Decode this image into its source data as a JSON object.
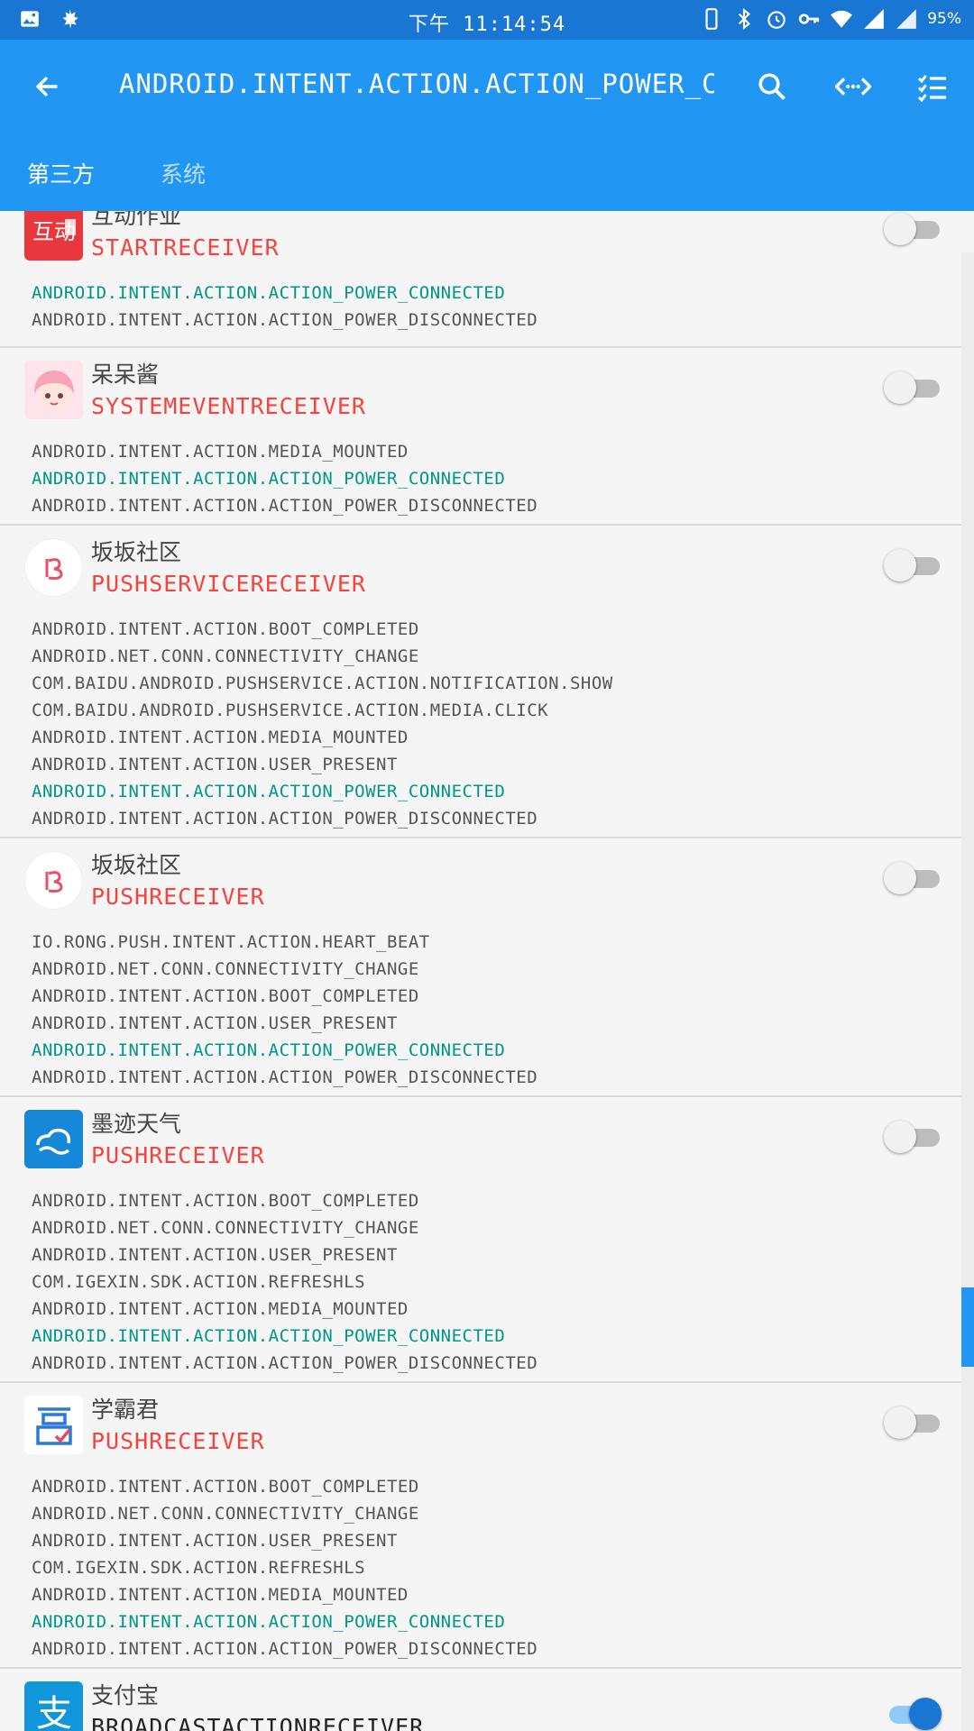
{
  "status_bar": {
    "time": "下午 11:14:54",
    "battery": "95%",
    "icons_left": [
      "image-icon",
      "leaf-icon"
    ],
    "icons_right": [
      "phone-icon",
      "bluetooth-icon",
      "alarm-icon",
      "key-icon",
      "wifi-icon",
      "signal-icon",
      "signal-icon",
      "battery-icon"
    ]
  },
  "toolbar": {
    "title": "ANDROID.INTENT.ACTION.ACTION_POWER_CO...",
    "actions": [
      "search-icon",
      "code-icon",
      "checklist-icon"
    ]
  },
  "tabs": [
    {
      "label": "第三方",
      "active": true
    },
    {
      "label": "系统",
      "active": false
    }
  ],
  "colors": {
    "status_bar": "#1976d2",
    "app_bar": "#2196f3",
    "receiver_disabled": "#f4433a",
    "highlight_action": "#009688"
  },
  "receivers": [
    {
      "app": "互动作业",
      "receiver": "STARTRECEIVER",
      "enabled": false,
      "icon": "hudong-icon",
      "actions": [
        {
          "text": "ANDROID.INTENT.ACTION.ACTION_POWER_CONNECTED",
          "highlight": true
        },
        {
          "text": "ANDROID.INTENT.ACTION.ACTION_POWER_DISCONNECTED",
          "highlight": false
        }
      ]
    },
    {
      "app": "呆呆酱",
      "receiver": "SYSTEMEVENTRECEIVER",
      "enabled": false,
      "icon": "anime-girl-icon",
      "actions": [
        {
          "text": "ANDROID.INTENT.ACTION.MEDIA_MOUNTED",
          "highlight": false
        },
        {
          "text": "ANDROID.INTENT.ACTION.ACTION_POWER_CONNECTED",
          "highlight": true
        },
        {
          "text": "ANDROID.INTENT.ACTION.ACTION_POWER_DISCONNECTED",
          "highlight": false
        }
      ]
    },
    {
      "app": "坂坂社区",
      "receiver": "PUSHSERVICERECEIVER",
      "enabled": false,
      "icon": "banban-icon",
      "actions": [
        {
          "text": "ANDROID.INTENT.ACTION.BOOT_COMPLETED",
          "highlight": false
        },
        {
          "text": "ANDROID.NET.CONN.CONNECTIVITY_CHANGE",
          "highlight": false
        },
        {
          "text": "COM.BAIDU.ANDROID.PUSHSERVICE.ACTION.NOTIFICATION.SHOW",
          "highlight": false
        },
        {
          "text": "COM.BAIDU.ANDROID.PUSHSERVICE.ACTION.MEDIA.CLICK",
          "highlight": false
        },
        {
          "text": "ANDROID.INTENT.ACTION.MEDIA_MOUNTED",
          "highlight": false
        },
        {
          "text": "ANDROID.INTENT.ACTION.USER_PRESENT",
          "highlight": false
        },
        {
          "text": "ANDROID.INTENT.ACTION.ACTION_POWER_CONNECTED",
          "highlight": true
        },
        {
          "text": "ANDROID.INTENT.ACTION.ACTION_POWER_DISCONNECTED",
          "highlight": false
        }
      ]
    },
    {
      "app": "坂坂社区",
      "receiver": "PUSHRECEIVER",
      "enabled": false,
      "icon": "banban-icon",
      "actions": [
        {
          "text": "IO.RONG.PUSH.INTENT.ACTION.HEART_BEAT",
          "highlight": false
        },
        {
          "text": "ANDROID.NET.CONN.CONNECTIVITY_CHANGE",
          "highlight": false
        },
        {
          "text": "ANDROID.INTENT.ACTION.BOOT_COMPLETED",
          "highlight": false
        },
        {
          "text": "ANDROID.INTENT.ACTION.USER_PRESENT",
          "highlight": false
        },
        {
          "text": "ANDROID.INTENT.ACTION.ACTION_POWER_CONNECTED",
          "highlight": true
        },
        {
          "text": "ANDROID.INTENT.ACTION.ACTION_POWER_DISCONNECTED",
          "highlight": false
        }
      ]
    },
    {
      "app": "墨迹天气",
      "receiver": "PUSHRECEIVER",
      "enabled": false,
      "icon": "moji-weather-icon",
      "actions": [
        {
          "text": "ANDROID.INTENT.ACTION.BOOT_COMPLETED",
          "highlight": false
        },
        {
          "text": "ANDROID.NET.CONN.CONNECTIVITY_CHANGE",
          "highlight": false
        },
        {
          "text": "ANDROID.INTENT.ACTION.USER_PRESENT",
          "highlight": false
        },
        {
          "text": "COM.IGEXIN.SDK.ACTION.REFRESHLS",
          "highlight": false
        },
        {
          "text": "ANDROID.INTENT.ACTION.MEDIA_MOUNTED",
          "highlight": false
        },
        {
          "text": "ANDROID.INTENT.ACTION.ACTION_POWER_CONNECTED",
          "highlight": true
        },
        {
          "text": "ANDROID.INTENT.ACTION.ACTION_POWER_DISCONNECTED",
          "highlight": false
        }
      ]
    },
    {
      "app": "学霸君",
      "receiver": "PUSHRECEIVER",
      "enabled": false,
      "icon": "xuebajun-icon",
      "actions": [
        {
          "text": "ANDROID.INTENT.ACTION.BOOT_COMPLETED",
          "highlight": false
        },
        {
          "text": "ANDROID.NET.CONN.CONNECTIVITY_CHANGE",
          "highlight": false
        },
        {
          "text": "ANDROID.INTENT.ACTION.USER_PRESENT",
          "highlight": false
        },
        {
          "text": "COM.IGEXIN.SDK.ACTION.REFRESHLS",
          "highlight": false
        },
        {
          "text": "ANDROID.INTENT.ACTION.MEDIA_MOUNTED",
          "highlight": false
        },
        {
          "text": "ANDROID.INTENT.ACTION.ACTION_POWER_CONNECTED",
          "highlight": true
        },
        {
          "text": "ANDROID.INTENT.ACTION.ACTION_POWER_DISCONNECTED",
          "highlight": false
        }
      ]
    },
    {
      "app": "支付宝",
      "receiver": "BROADCASTACTIONRECEIVER",
      "enabled": true,
      "icon": "alipay-icon",
      "actions": []
    }
  ]
}
